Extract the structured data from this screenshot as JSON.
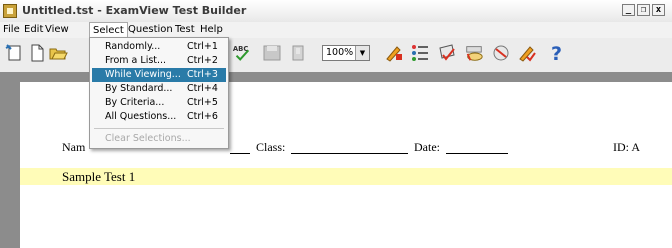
{
  "window": {
    "title": "Untitled.tst - ExamView Test Builder",
    "min_label": "_",
    "restore_label": "❐",
    "close_label": "x"
  },
  "menubar": {
    "items": [
      {
        "label": "File"
      },
      {
        "label": "Edit"
      },
      {
        "label": "View"
      },
      {
        "label": "Select"
      },
      {
        "label": "Question"
      },
      {
        "label": "Test"
      },
      {
        "label": "Help"
      }
    ]
  },
  "toolbar": {
    "zoom_value": "100%",
    "spell_label": "ABC"
  },
  "select_menu": {
    "items": [
      {
        "label": "Randomly...",
        "shortcut": "Ctrl+1"
      },
      {
        "label": "From a List...",
        "shortcut": "Ctrl+2"
      },
      {
        "label": "While Viewing...",
        "shortcut": "Ctrl+3"
      },
      {
        "label": "By Standard...",
        "shortcut": "Ctrl+4"
      },
      {
        "label": "By Criteria...",
        "shortcut": "Ctrl+5"
      },
      {
        "label": "All Questions...",
        "shortcut": "Ctrl+6"
      },
      {
        "label": "Clear Selections...",
        "shortcut": ""
      }
    ]
  },
  "document": {
    "name_label": "Nam",
    "class_label": "Class:",
    "date_label": "Date:",
    "id_label": "ID: A",
    "test_title": "Sample Test 1"
  },
  "colors": {
    "highlight": "#2a7ba8",
    "title_band": "#fffcb8"
  }
}
